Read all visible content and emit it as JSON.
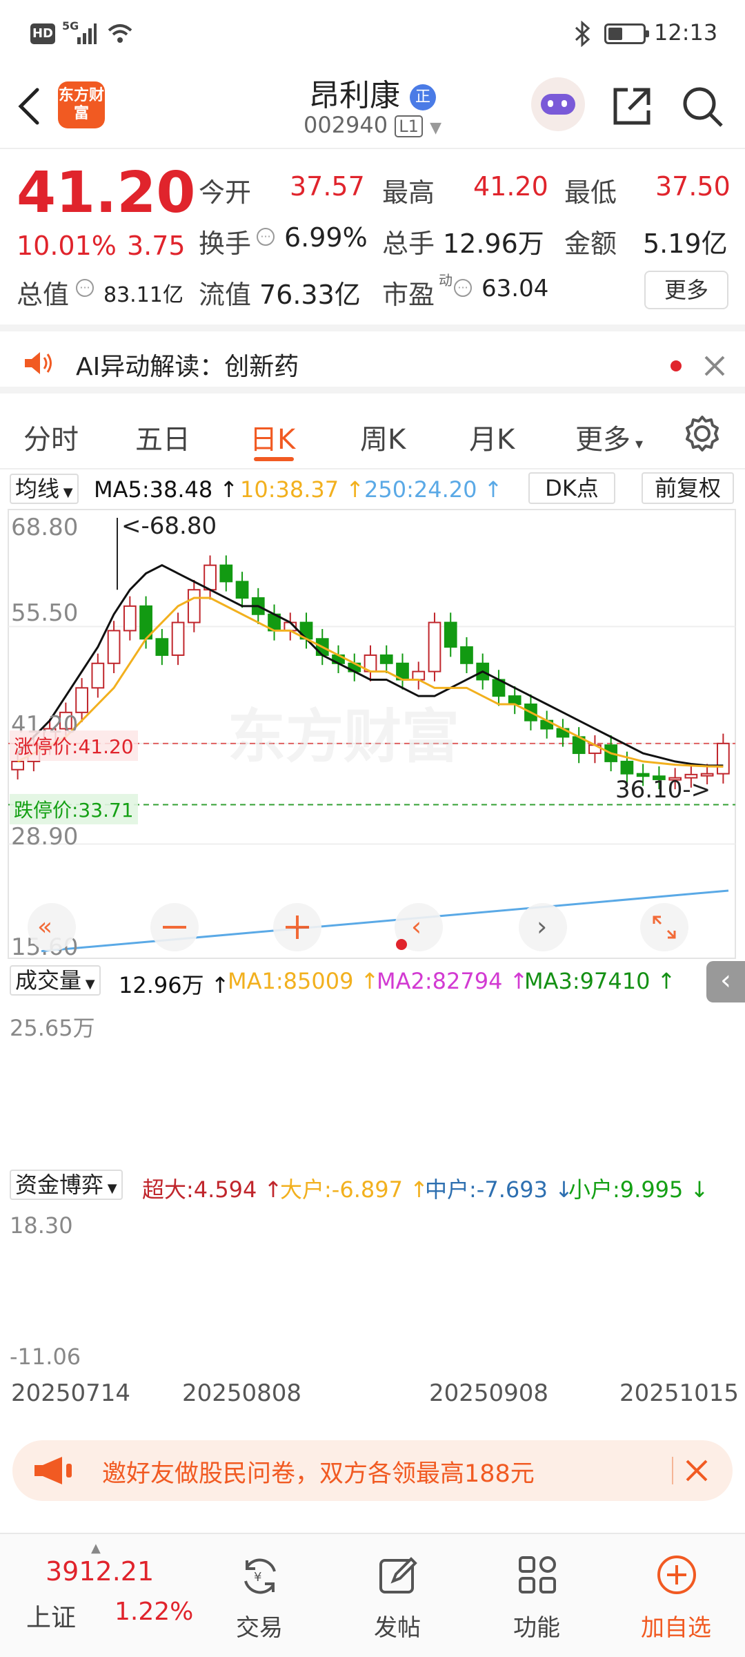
{
  "status_bar": {
    "network": "HD",
    "signal": "5G",
    "time": "12:13"
  },
  "header": {
    "logo_text": "东方财富",
    "stock_name": "昂利康",
    "stock_badge": "正",
    "stock_code": "002940",
    "level": "L1"
  },
  "quote": {
    "price": "41.20",
    "change_pct": "10.01%",
    "change_amt": "3.75",
    "open_label": "今开",
    "open": "37.57",
    "high_label": "最高",
    "high": "41.20",
    "low_label": "最低",
    "low": "37.50",
    "turnover_label": "换手",
    "turnover": "6.99%",
    "volume_label": "总手",
    "volume": "12.96万",
    "amount_label": "金额",
    "amount": "5.19亿",
    "mktcap_label": "总值",
    "mktcap": "83.11亿",
    "float_label": "流值",
    "float_cap": "76.33亿",
    "pe_label": "市盈",
    "pe_sup": "动",
    "pe": "63.04",
    "more_button": "更多"
  },
  "ai_row": {
    "label": "AI异动解读：创新药"
  },
  "tabs": {
    "items": [
      "分时",
      "五日",
      "日K",
      "周K",
      "月K",
      "更多"
    ],
    "active": "日K"
  },
  "kline_legend": {
    "select": "均线",
    "ma5": "MA5:38.48 ↑",
    "ma10": "10:38.37 ↑",
    "ma250": "250:24.20 ↑",
    "dk_button": "DK点",
    "fq_button": "前复权",
    "colors": {
      "ma5": "#111111",
      "ma10": "#f2b01e",
      "ma250": "#5aa9e6"
    }
  },
  "kline_labels": {
    "y_ticks": [
      "68.80",
      "55.50",
      "41.20",
      "28.90",
      "15.60"
    ],
    "max_label": "<-68.80",
    "min_label": "36.10->",
    "limit_up": "涨停价:41.20",
    "limit_down": "跌停价:33.71",
    "watermark": "东方财富"
  },
  "volume_legend": {
    "select": "成交量",
    "vol": "12.96万 ↑",
    "ma1": "MA1:85009 ↑",
    "ma2": "MA2:82794 ↑",
    "ma3": "MA3:97410 ↑",
    "y_max": "25.65万"
  },
  "fund_legend": {
    "select": "资金博弈",
    "super": "超大:4.594 ↑",
    "large": "大户:-6.897 ↑",
    "mid": "中户:-7.693 ↓",
    "small": "小户:9.995 ↓",
    "y_max": "18.30",
    "y_min": "-11.06"
  },
  "x_dates": [
    "20250714",
    "20250808",
    "20250908",
    "20251015"
  ],
  "chart_data": {
    "type": "candlestick",
    "ylim": [
      15.6,
      68.8
    ],
    "max": 68.8,
    "min": 36.1,
    "series": [
      {
        "name": "MA5",
        "values": [
          40,
          42,
          44,
          47,
          50,
          53,
          57,
          60,
          62,
          63,
          62,
          61,
          60,
          59,
          58,
          58,
          57,
          56,
          54,
          52,
          51,
          50,
          49,
          49,
          48,
          47,
          47,
          48,
          49,
          50,
          49,
          48,
          47,
          46,
          45,
          44,
          43,
          42,
          41,
          40,
          39.5,
          39,
          38.7,
          38.5,
          38.5
        ]
      },
      {
        "name": "MA10",
        "values": [
          39,
          40,
          41,
          42,
          44,
          46,
          48,
          51,
          54,
          56,
          58,
          59,
          59,
          58,
          57,
          56,
          55,
          55,
          54,
          53,
          52,
          51,
          50,
          50,
          49,
          49,
          48,
          48,
          48,
          47,
          46,
          46,
          45,
          44,
          43,
          42,
          41,
          40,
          39.5,
          39,
          38.8,
          38.6,
          38.5,
          38.4,
          38.37
        ]
      }
    ],
    "candles_close": [
      39,
      41,
      43,
      45,
      48,
      51,
      55,
      58,
      54,
      52,
      56,
      60,
      63,
      61,
      59,
      57,
      55,
      56,
      54,
      52,
      51,
      50,
      52,
      51,
      49,
      50,
      56,
      53,
      51,
      49,
      47,
      46,
      44,
      43,
      42,
      40,
      41,
      39,
      37.5,
      37.2,
      36.8,
      37,
      37.4,
      37.5,
      41.2
    ]
  },
  "banner": {
    "text": "邀好友做股民问卷，双方各领最高188元"
  },
  "bottom_nav": {
    "index_value": "3912.21",
    "index_name": "上证",
    "index_change": "1.22%",
    "items": [
      "交易",
      "发帖",
      "功能",
      "加自选"
    ]
  }
}
